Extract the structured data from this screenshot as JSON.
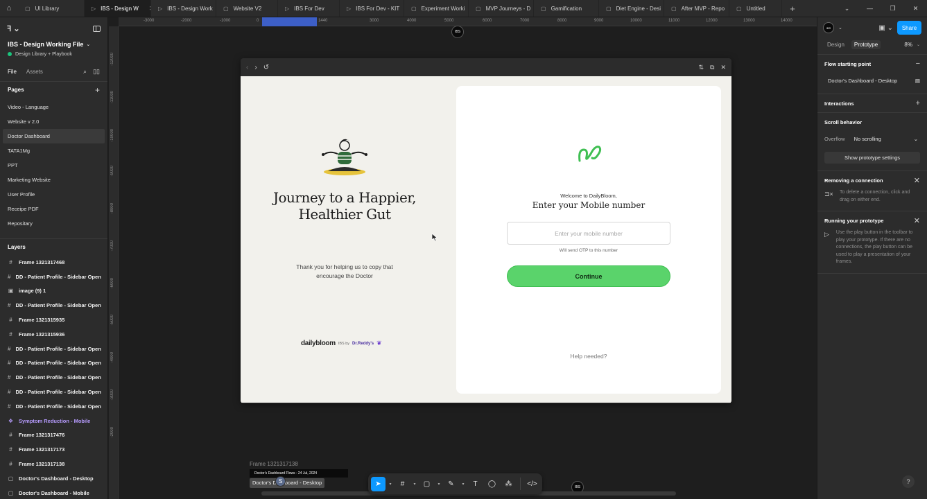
{
  "tabs": [
    {
      "label": "UI Library",
      "icon": "file-icon",
      "active": false
    },
    {
      "label": "IBS - Design W",
      "icon": "play-icon",
      "active": true
    },
    {
      "label": "IBS - Design Work",
      "icon": "play-icon",
      "active": false
    },
    {
      "label": "Website V2",
      "icon": "file-icon",
      "active": false
    },
    {
      "label": "IBS For Dev",
      "icon": "play-icon",
      "active": false
    },
    {
      "label": "IBS For Dev - KIT",
      "icon": "play-icon",
      "active": false
    },
    {
      "label": "Experiment Worki",
      "icon": "file-icon",
      "active": false
    },
    {
      "label": "MVP Journeys - D",
      "icon": "file-icon",
      "active": false
    },
    {
      "label": "Gamification",
      "icon": "file-icon",
      "active": false
    },
    {
      "label": "Diet Engine - Desi",
      "icon": "file-icon",
      "active": false
    },
    {
      "label": "After MVP - Repo",
      "icon": "file-icon",
      "active": false
    },
    {
      "label": "Untitled",
      "icon": "file-icon",
      "active": false
    }
  ],
  "file": {
    "title": "IBS - Design Working File",
    "team": "Design Library + Playbook"
  },
  "left_tabs": {
    "file": "File",
    "assets": "Assets"
  },
  "pages_heading": "Pages",
  "pages": [
    {
      "label": "Video - Language",
      "selected": false
    },
    {
      "label": "Website v 2.0",
      "selected": false
    },
    {
      "label": "Doctor Dashboard",
      "selected": true
    },
    {
      "label": "TATA1Mg",
      "selected": false
    },
    {
      "label": "PPT",
      "selected": false
    },
    {
      "label": "Marketing Website",
      "selected": false
    },
    {
      "label": "User Profile",
      "selected": false
    },
    {
      "label": "Receipe PDF",
      "selected": false
    },
    {
      "label": "Repositary",
      "selected": false
    }
  ],
  "layers_heading": "Layers",
  "layers": [
    {
      "label": "Frame 1321317468",
      "icon": "frame-icon",
      "type": "frame"
    },
    {
      "label": "DD - Patient Profile - Sidebar Open",
      "icon": "frame-icon",
      "type": "frame"
    },
    {
      "label": "image (9) 1",
      "icon": "image-icon",
      "type": "image"
    },
    {
      "label": "DD - Patient Profile - Sidebar Open",
      "icon": "frame-icon",
      "type": "frame"
    },
    {
      "label": "Frame 1321315935",
      "icon": "frame-icon",
      "type": "frame"
    },
    {
      "label": "Frame 1321315936",
      "icon": "frame-icon",
      "type": "frame"
    },
    {
      "label": "DD - Patient Profile - Sidebar Open",
      "icon": "frame-icon",
      "type": "frame"
    },
    {
      "label": "DD - Patient Profile - Sidebar Open",
      "icon": "frame-icon",
      "type": "frame"
    },
    {
      "label": "DD - Patient Profile - Sidebar Open",
      "icon": "frame-icon",
      "type": "frame"
    },
    {
      "label": "DD - Patient Profile - Sidebar Open",
      "icon": "frame-icon",
      "type": "frame"
    },
    {
      "label": "DD - Patient Profile - Sidebar Open",
      "icon": "frame-icon",
      "type": "frame"
    },
    {
      "label": "Symptom Reduction - Mobile",
      "icon": "component-icon",
      "type": "component"
    },
    {
      "label": "Frame 1321317476",
      "icon": "frame-icon",
      "type": "frame"
    },
    {
      "label": "Frame 1321317173",
      "icon": "frame-icon",
      "type": "frame"
    },
    {
      "label": "Frame 1321317138",
      "icon": "frame-icon",
      "type": "frame"
    },
    {
      "label": "Doctor's Dashboard - Desktop",
      "icon": "section-icon",
      "type": "frame"
    },
    {
      "label": "Doctor's Dashboard - Mobile",
      "icon": "section-icon",
      "type": "frame"
    }
  ],
  "ruler": {
    "top": [
      "-3000",
      "-2000",
      "-1000",
      "0",
      "1440",
      "3000",
      "4000",
      "5000",
      "6000",
      "7000",
      "8000",
      "9000",
      "10000",
      "11000",
      "12000",
      "13000",
      "14000"
    ],
    "left": [
      "-12000",
      "-11000",
      "-10000",
      "-9000",
      "-8000",
      "-7000",
      "-6000",
      "-5000",
      "-4000",
      "-3000",
      "-2000"
    ]
  },
  "prototype": {
    "journey_title": "Journey to a Happier, Healthier Gut",
    "thanks_text": "Thank you for helping us to copy that encourage the Doctor",
    "brand_name": "dailybloom",
    "brand_by": "IBS by",
    "brand_partner": "Dr.Reddy's",
    "welcome": "Welcome to DailyBloom,",
    "enter_title": "Enter your Mobile number",
    "mobile_placeholder": "Enter your mobile number",
    "otp_note": "Will send OTP to this  number",
    "continue_label": "Continue",
    "help_text": "Help needed?",
    "accent_green": "#5ad36b",
    "brand_purple": "#6c3bd0"
  },
  "canvas": {
    "frame_label": "Frame 1321317138",
    "mini_frame_text": "Doctor's Dashboard Flows - 24 Jul, 2024",
    "name_tag": "Doctor's Dashboard - Desktop",
    "user_initial": "S"
  },
  "toolbar": {
    "tools": [
      "move-tool-icon",
      "frame-tool-icon",
      "shape-tool-icon",
      "pen-tool-icon",
      "text-tool-icon",
      "comment-tool-icon",
      "actions-tool-icon",
      "dev-mode-icon"
    ]
  },
  "right": {
    "share_label": "Share",
    "tab_design": "Design",
    "tab_prototype": "Prototype",
    "zoom": "8%",
    "flow_heading": "Flow starting point",
    "flow_name": "Doctor's Dashboard - Desktop",
    "interactions_heading": "Interactions",
    "scroll_heading": "Scroll behavior",
    "overflow_label": "Overflow",
    "overflow_value": "No scrolling",
    "proto_settings_label": "Show prototype settings",
    "removing_heading": "Removing a connection",
    "removing_text": "To delete a connection, click and drag on either end.",
    "running_heading": "Running your prototype",
    "running_text": "Use the play button in the toolbar to play your prototype. If there are no connections, the play button can be used to play a presentation of your frames.",
    "help_label": "?",
    "accent_blue": "#0d99ff"
  }
}
